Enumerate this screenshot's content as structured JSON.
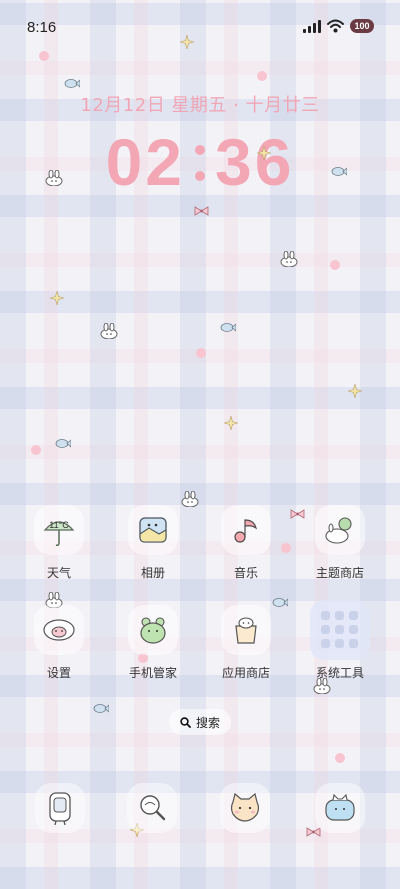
{
  "status_bar": {
    "time": "8:16",
    "battery": "100"
  },
  "lock": {
    "date": "12月12日 星期五 · 十月廿三",
    "hours": "02",
    "minutes": "36"
  },
  "apps": [
    {
      "label": "天气",
      "temp": "11°C"
    },
    {
      "label": "相册"
    },
    {
      "label": "音乐"
    },
    {
      "label": "主题商店"
    },
    {
      "label": "设置"
    },
    {
      "label": "手机管家"
    },
    {
      "label": "应用商店"
    },
    {
      "label": "系统工具"
    }
  ],
  "search": {
    "label": "搜索"
  },
  "dock": [
    {
      "name": "phone-icon"
    },
    {
      "name": "magnifier-icon"
    },
    {
      "name": "cat-face-icon"
    },
    {
      "name": "camera-cat-icon"
    }
  ],
  "colors": {
    "accent_pink": "#f3a7b5",
    "battery": "#6b3b44"
  }
}
